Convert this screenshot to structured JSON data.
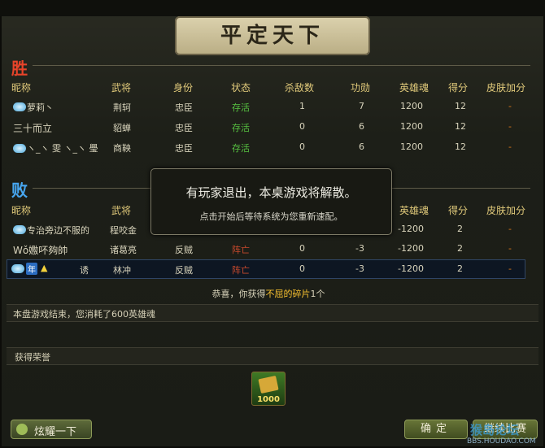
{
  "title": "平定天下",
  "win": {
    "label": "胜",
    "headers": [
      "昵称",
      "武将",
      "身份",
      "状态",
      "杀敌数",
      "功勋",
      "英雄魂",
      "得分",
      "皮肤加分"
    ],
    "rows": [
      {
        "name": "萝莉丶",
        "hero": "荆轲",
        "role": "忠臣",
        "status": "存活",
        "kills": "1",
        "merit": "7",
        "soul": "1200",
        "score": "12",
        "skin": "-"
      },
      {
        "name": "三十而立",
        "hero": "貂蝉",
        "role": "忠臣",
        "status": "存活",
        "kills": "0",
        "merit": "6",
        "soul": "1200",
        "score": "12",
        "skin": "-"
      },
      {
        "name": "ヽ_ヽ 雯 ヽ_ヽ 璺",
        "hero": "商鞅",
        "role": "忠臣",
        "status": "存活",
        "kills": "0",
        "merit": "6",
        "soul": "1200",
        "score": "12",
        "skin": "-"
      }
    ]
  },
  "lose": {
    "label": "败",
    "headers": [
      "昵称",
      "武将",
      "英雄魂",
      "得分",
      "皮肤加分"
    ],
    "rows": [
      {
        "name": "专治旁边不服的",
        "hero": "程咬金",
        "role": "",
        "status": "",
        "kills": "",
        "merit": "",
        "soul": "-1200",
        "score": "2",
        "skin": "-"
      },
      {
        "name": "Wǒ嫐吥夠帥",
        "hero": "诸葛亮",
        "role": "反贼",
        "status": "阵亡",
        "kills": "0",
        "merit": "-3",
        "soul": "-1200",
        "score": "2",
        "skin": "-"
      },
      {
        "name": "诱",
        "hero": "林冲",
        "role": "反贼",
        "status": "阵亡",
        "kills": "0",
        "merit": "-3",
        "soul": "-1200",
        "score": "2",
        "skin": "-",
        "tag": "年",
        "warn": "▲"
      }
    ]
  },
  "modal": {
    "line1": "有玩家退出，本桌游戏将解散。",
    "line2": "点击开始后等待系统为您重新速配。"
  },
  "fragment": {
    "prefix": "恭喜，你获得",
    "highlight": "不屈的碎片",
    "suffix": "1个"
  },
  "end_message": "本盘游戏结束，您消耗了600英雄魂",
  "honor": {
    "label": "获得荣誉",
    "value": "1000"
  },
  "buttons": {
    "show_off": "炫耀一下",
    "confirm": "确定",
    "continue": "继续比赛"
  },
  "watermark": {
    "main": "猴岛论坛",
    "url": "BBS.HOUDAO.COM"
  }
}
